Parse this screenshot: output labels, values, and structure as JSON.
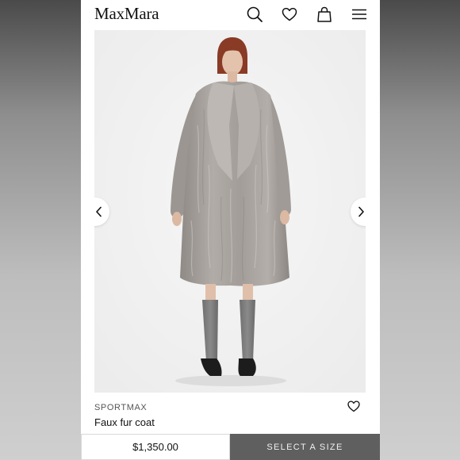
{
  "header": {
    "logo": "MaxMara",
    "icons": [
      "search-icon",
      "heart-icon",
      "shopping-bag-icon",
      "hamburger-menu-icon"
    ]
  },
  "gallery": {
    "prev_icon": "chevron-left-icon",
    "next_icon": "chevron-right-icon"
  },
  "product": {
    "brand": "SPORTMAX",
    "name": "Faux fur coat",
    "wishlist_icon": "heart-outline-icon"
  },
  "purchase": {
    "price": "$1,350.00",
    "select_size_label": "SELECT A SIZE"
  },
  "colors": {
    "select_button_bg": "#5f5f5f",
    "coat": "#a49f9a",
    "image_bg": "#f3f3f3"
  }
}
